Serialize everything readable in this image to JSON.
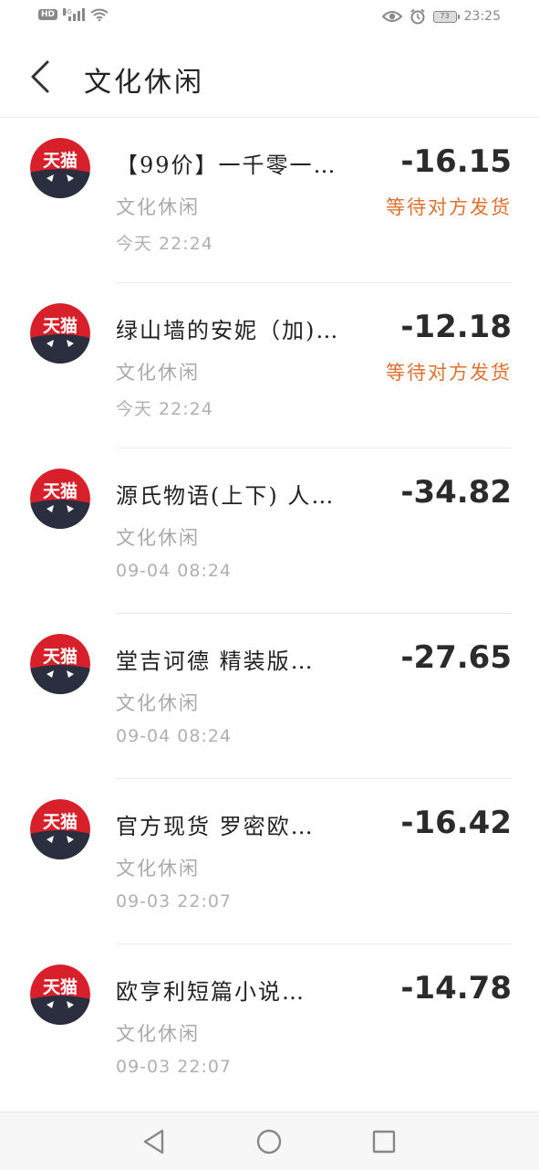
{
  "status_bar": {
    "hd": "HD",
    "network": "4G",
    "battery": "73",
    "time": "23:25"
  },
  "header": {
    "title": "文化休闲"
  },
  "logo_text": "天猫",
  "transactions": [
    {
      "name": "【99价】一千零一…",
      "category": "文化休闲",
      "time": "今天  22:24",
      "amount": "-16.15",
      "status": "等待对方发货"
    },
    {
      "name": "绿山墙的安妮（加)…",
      "category": "文化休闲",
      "time": "今天  22:24",
      "amount": "-12.18",
      "status": "等待对方发货"
    },
    {
      "name": "源氏物语(上下) 人…",
      "category": "文化休闲",
      "time": "09-04  08:24",
      "amount": "-34.82",
      "status": ""
    },
    {
      "name": "堂吉诃德 精装版…",
      "category": "文化休闲",
      "time": "09-04  08:24",
      "amount": "-27.65",
      "status": ""
    },
    {
      "name": "官方现货 罗密欧…",
      "category": "文化休闲",
      "time": "09-03  22:07",
      "amount": "-16.42",
      "status": ""
    },
    {
      "name": "欧亨利短篇小说…",
      "category": "文化休闲",
      "time": "09-03  22:07",
      "amount": "-14.78",
      "status": ""
    }
  ],
  "colors": {
    "accent_status": "#e07030",
    "tmall_red": "#d8202a",
    "tmall_dark": "#2a2e3e"
  },
  "icons": {
    "back": "chevron-left-icon",
    "eye": "eye-icon",
    "alarm": "alarm-icon",
    "nav_back": "triangle-back-icon",
    "nav_home": "circle-home-icon",
    "nav_recent": "square-recent-icon"
  }
}
